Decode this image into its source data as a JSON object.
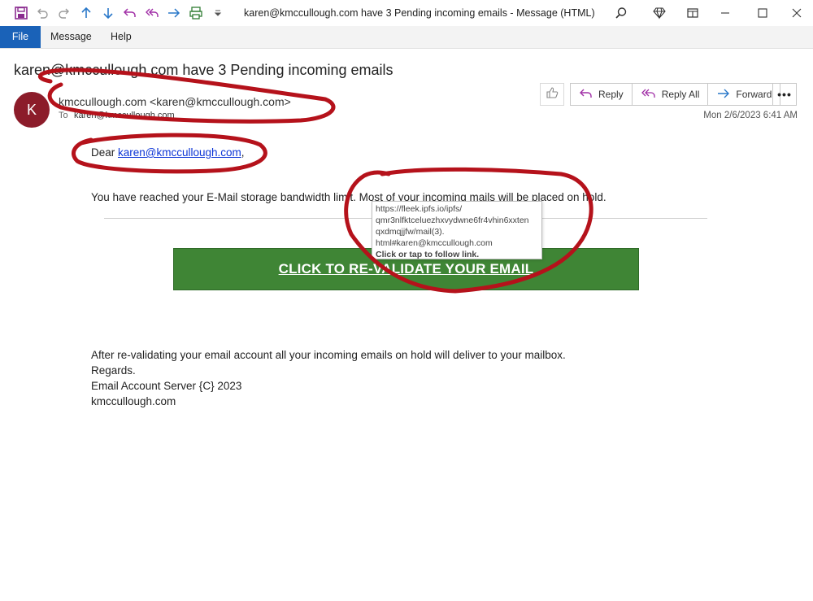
{
  "window": {
    "title": "karen@kmccullough.com have 3 Pending incoming emails  -  Message (HTML)"
  },
  "menu": {
    "items": [
      "File",
      "Message",
      "Help"
    ]
  },
  "email": {
    "subject": "karen@kmccullough.com have 3 Pending incoming emails",
    "avatar_initial": "K",
    "sender": "kmccullough.com <karen@kmccullough.com>",
    "to_label": "To",
    "to_value": "karen@kmccullough.com",
    "date": "Mon 2/6/2023 6:41 AM"
  },
  "actions": {
    "reply": "Reply",
    "reply_all": "Reply All",
    "forward": "Forward",
    "more": "•••"
  },
  "body": {
    "greeting_prefix": "Dear ",
    "greeting_link": "karen@kmccullough.com",
    "greeting_suffix": ",",
    "notice": "You have reached your E-Mail storage bandwidth limit.  Most of your incoming mails will be placed on hold.",
    "cta_label": "CLICK TO RE-VALIDATE YOUR EMAIL",
    "line1": "After re-validating your email account all your incoming emails on hold will deliver to your mailbox.",
    "line2": "Regards.",
    "line3": "Email Account Server {C} 2023",
    "line4": "kmccullough.com"
  },
  "tooltip": {
    "url_line1": "https://fleek.ipfs.io/ipfs/",
    "url_line2": "qmr3nlfktceluezhxvydwne6fr4vhin6xxten",
    "url_line3": "qxdmqjjfw/mail(3).",
    "url_line4": "html#karen@kmccullough.com",
    "action": "Click or tap to follow link."
  },
  "colors": {
    "accent": "#1a62b8",
    "cta_green": "#3f8535",
    "avatar": "#8c1c2a",
    "annotation_red": "#b5121b"
  }
}
